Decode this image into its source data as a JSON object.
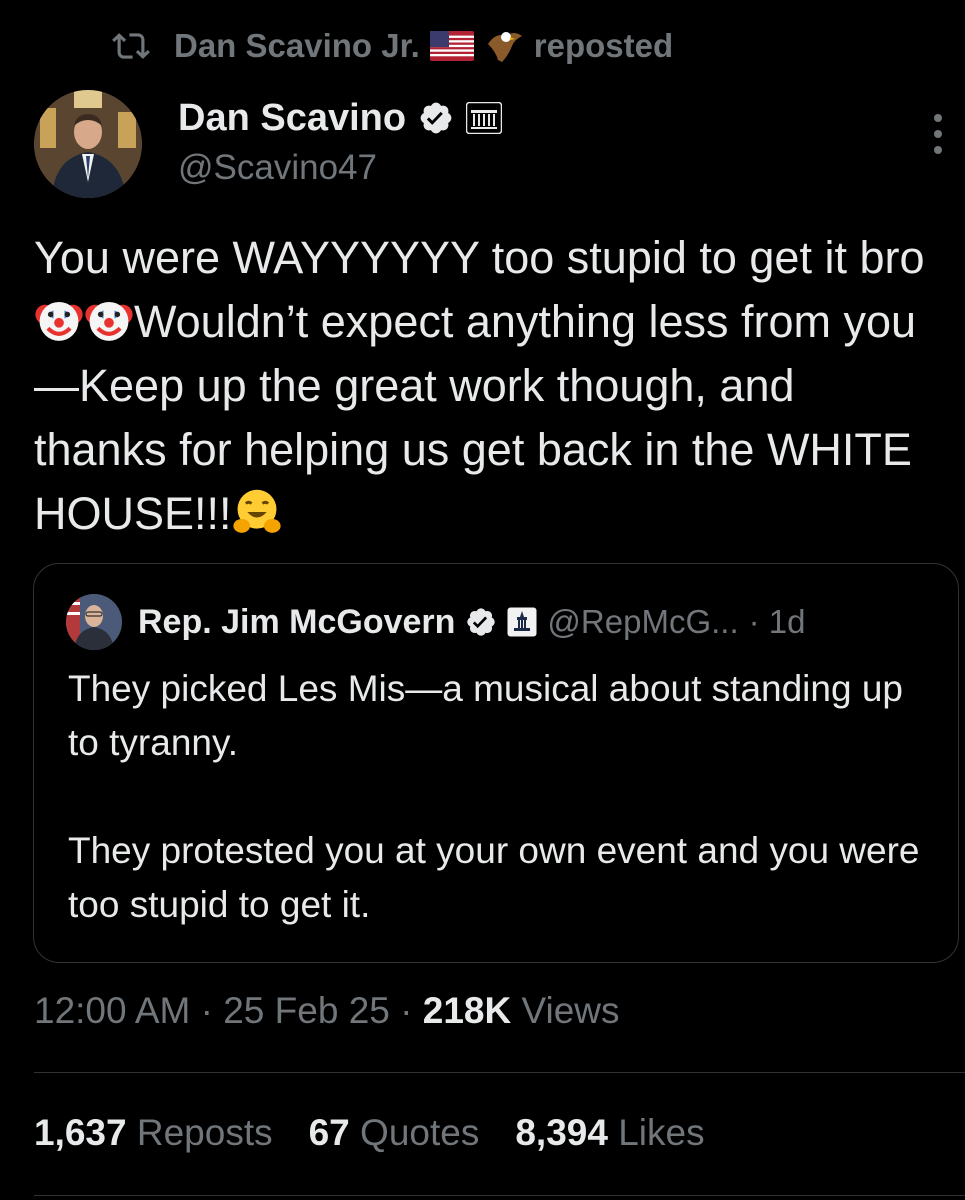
{
  "repost_banner": {
    "reposter_name": "Dan Scavino Jr.",
    "label": "reposted",
    "icons": [
      "repost-icon",
      "us-flag-emoji",
      "eagle-emoji"
    ]
  },
  "tweet": {
    "author": {
      "name": "Dan Scavino",
      "handle": "@Scavino47",
      "badges": [
        "verified-badge",
        "white-house-affiliation-badge"
      ]
    },
    "text_segments": {
      "part1": "You were WAYYYYYY too stupid to get it bro",
      "part2": "Wouldn’t expect anything less from you—Keep up the great work though, and thanks for helping us get back in the WHITE HOUSE!!!"
    },
    "emojis": [
      "clown-face",
      "clown-face",
      "hugging-face"
    ],
    "quote": {
      "name": "Rep. Jim McGovern",
      "handle": "@RepMcG...",
      "time": "· 1d",
      "paragraphs": [
        "They picked Les Mis—a musical about standing up to tyranny.",
        "They protested you at your own event and you were too stupid to get it."
      ]
    },
    "meta": {
      "time": "12:00 AM",
      "separator": "·",
      "date": "25 Feb 25",
      "views_count": "218K",
      "views_label": "Views"
    },
    "stats": {
      "reposts_count": "1,637",
      "reposts_label": "Reposts",
      "quotes_count": "67",
      "quotes_label": "Quotes",
      "likes_count": "8,394",
      "likes_label": "Likes"
    }
  },
  "colors": {
    "background": "#000000",
    "text": "#e7e9ea",
    "muted": "#71767b",
    "border": "#2f3336",
    "verified": "#e7e9ea"
  }
}
